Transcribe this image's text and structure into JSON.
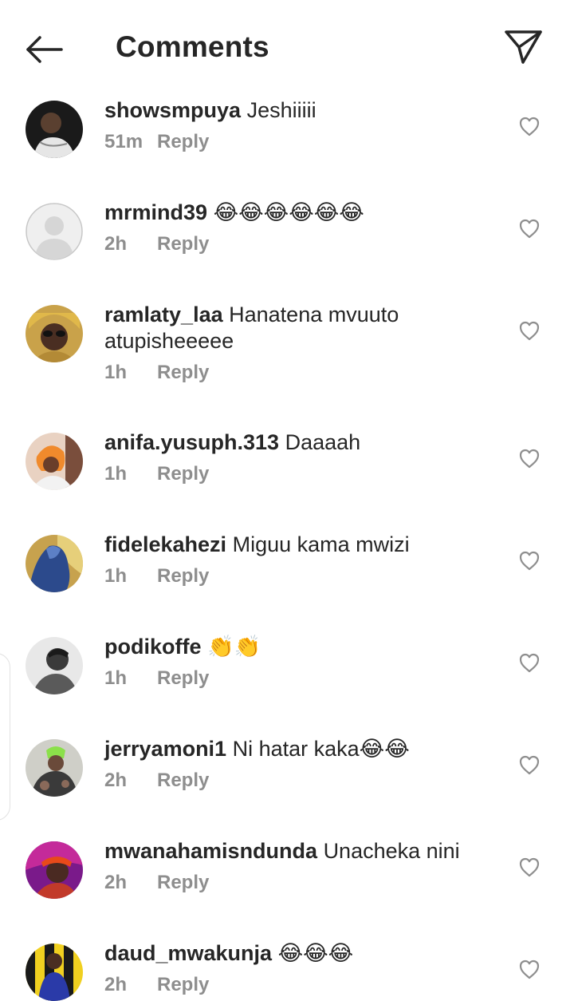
{
  "header": {
    "title": "Comments",
    "back_icon": "arrow-left-icon",
    "share_icon": "paper-plane-icon"
  },
  "colors": {
    "text": "#262626",
    "meta": "#8e8e8e",
    "background": "#ffffff"
  },
  "reply_label": "Reply",
  "comments": [
    {
      "username": "showsmpuya",
      "text": "Jeshiiiii",
      "time": "51m",
      "reply": "Reply"
    },
    {
      "username": "mrmind39",
      "text": "😂😂😂😂😂😂",
      "time": "2h",
      "reply": "Reply"
    },
    {
      "username": "ramlaty_laa",
      "text": "Hanatena mvuuto atupisheeeee",
      "time": "1h",
      "reply": "Reply"
    },
    {
      "username": "anifa.yusuph.313",
      "text": "Daaaah",
      "time": "1h",
      "reply": "Reply"
    },
    {
      "username": "fidelekahezi",
      "text": "Miguu kama mwizi",
      "time": "1h",
      "reply": "Reply"
    },
    {
      "username": "podikoffe",
      "text": "👏👏",
      "time": "1h",
      "reply": "Reply"
    },
    {
      "username": "jerryamoni1",
      "text": "Ni hatar kaka😂😂",
      "time": "2h",
      "reply": "Reply"
    },
    {
      "username": "mwanahamisndunda",
      "text": "Unacheka nini",
      "time": "2h",
      "reply": "Reply"
    },
    {
      "username": "daud_mwakunja",
      "text": "😂😂😂",
      "time": "2h",
      "reply": "Reply"
    }
  ]
}
